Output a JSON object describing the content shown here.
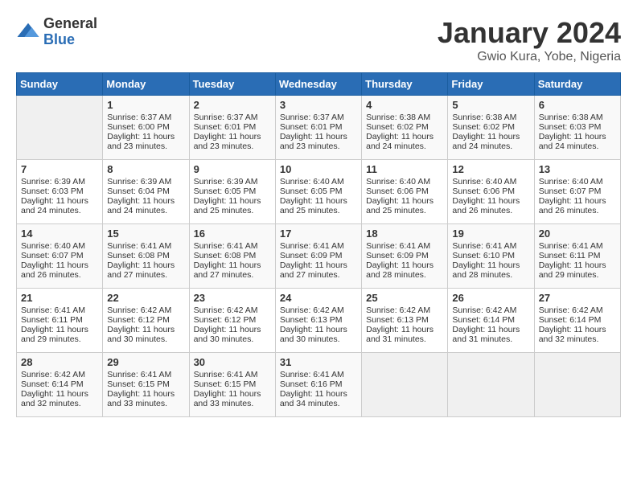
{
  "header": {
    "logo_general": "General",
    "logo_blue": "Blue",
    "month_title": "January 2024",
    "location": "Gwio Kura, Yobe, Nigeria"
  },
  "weekdays": [
    "Sunday",
    "Monday",
    "Tuesday",
    "Wednesday",
    "Thursday",
    "Friday",
    "Saturday"
  ],
  "weeks": [
    [
      {
        "day": "",
        "sunrise": "",
        "sunset": "",
        "daylight": ""
      },
      {
        "day": "1",
        "sunrise": "Sunrise: 6:37 AM",
        "sunset": "Sunset: 6:00 PM",
        "daylight": "Daylight: 11 hours and 23 minutes."
      },
      {
        "day": "2",
        "sunrise": "Sunrise: 6:37 AM",
        "sunset": "Sunset: 6:01 PM",
        "daylight": "Daylight: 11 hours and 23 minutes."
      },
      {
        "day": "3",
        "sunrise": "Sunrise: 6:37 AM",
        "sunset": "Sunset: 6:01 PM",
        "daylight": "Daylight: 11 hours and 23 minutes."
      },
      {
        "day": "4",
        "sunrise": "Sunrise: 6:38 AM",
        "sunset": "Sunset: 6:02 PM",
        "daylight": "Daylight: 11 hours and 24 minutes."
      },
      {
        "day": "5",
        "sunrise": "Sunrise: 6:38 AM",
        "sunset": "Sunset: 6:02 PM",
        "daylight": "Daylight: 11 hours and 24 minutes."
      },
      {
        "day": "6",
        "sunrise": "Sunrise: 6:38 AM",
        "sunset": "Sunset: 6:03 PM",
        "daylight": "Daylight: 11 hours and 24 minutes."
      }
    ],
    [
      {
        "day": "7",
        "sunrise": "Sunrise: 6:39 AM",
        "sunset": "Sunset: 6:03 PM",
        "daylight": "Daylight: 11 hours and 24 minutes."
      },
      {
        "day": "8",
        "sunrise": "Sunrise: 6:39 AM",
        "sunset": "Sunset: 6:04 PM",
        "daylight": "Daylight: 11 hours and 24 minutes."
      },
      {
        "day": "9",
        "sunrise": "Sunrise: 6:39 AM",
        "sunset": "Sunset: 6:05 PM",
        "daylight": "Daylight: 11 hours and 25 minutes."
      },
      {
        "day": "10",
        "sunrise": "Sunrise: 6:40 AM",
        "sunset": "Sunset: 6:05 PM",
        "daylight": "Daylight: 11 hours and 25 minutes."
      },
      {
        "day": "11",
        "sunrise": "Sunrise: 6:40 AM",
        "sunset": "Sunset: 6:06 PM",
        "daylight": "Daylight: 11 hours and 25 minutes."
      },
      {
        "day": "12",
        "sunrise": "Sunrise: 6:40 AM",
        "sunset": "Sunset: 6:06 PM",
        "daylight": "Daylight: 11 hours and 26 minutes."
      },
      {
        "day": "13",
        "sunrise": "Sunrise: 6:40 AM",
        "sunset": "Sunset: 6:07 PM",
        "daylight": "Daylight: 11 hours and 26 minutes."
      }
    ],
    [
      {
        "day": "14",
        "sunrise": "Sunrise: 6:40 AM",
        "sunset": "Sunset: 6:07 PM",
        "daylight": "Daylight: 11 hours and 26 minutes."
      },
      {
        "day": "15",
        "sunrise": "Sunrise: 6:41 AM",
        "sunset": "Sunset: 6:08 PM",
        "daylight": "Daylight: 11 hours and 27 minutes."
      },
      {
        "day": "16",
        "sunrise": "Sunrise: 6:41 AM",
        "sunset": "Sunset: 6:08 PM",
        "daylight": "Daylight: 11 hours and 27 minutes."
      },
      {
        "day": "17",
        "sunrise": "Sunrise: 6:41 AM",
        "sunset": "Sunset: 6:09 PM",
        "daylight": "Daylight: 11 hours and 27 minutes."
      },
      {
        "day": "18",
        "sunrise": "Sunrise: 6:41 AM",
        "sunset": "Sunset: 6:09 PM",
        "daylight": "Daylight: 11 hours and 28 minutes."
      },
      {
        "day": "19",
        "sunrise": "Sunrise: 6:41 AM",
        "sunset": "Sunset: 6:10 PM",
        "daylight": "Daylight: 11 hours and 28 minutes."
      },
      {
        "day": "20",
        "sunrise": "Sunrise: 6:41 AM",
        "sunset": "Sunset: 6:11 PM",
        "daylight": "Daylight: 11 hours and 29 minutes."
      }
    ],
    [
      {
        "day": "21",
        "sunrise": "Sunrise: 6:41 AM",
        "sunset": "Sunset: 6:11 PM",
        "daylight": "Daylight: 11 hours and 29 minutes."
      },
      {
        "day": "22",
        "sunrise": "Sunrise: 6:42 AM",
        "sunset": "Sunset: 6:12 PM",
        "daylight": "Daylight: 11 hours and 30 minutes."
      },
      {
        "day": "23",
        "sunrise": "Sunrise: 6:42 AM",
        "sunset": "Sunset: 6:12 PM",
        "daylight": "Daylight: 11 hours and 30 minutes."
      },
      {
        "day": "24",
        "sunrise": "Sunrise: 6:42 AM",
        "sunset": "Sunset: 6:13 PM",
        "daylight": "Daylight: 11 hours and 30 minutes."
      },
      {
        "day": "25",
        "sunrise": "Sunrise: 6:42 AM",
        "sunset": "Sunset: 6:13 PM",
        "daylight": "Daylight: 11 hours and 31 minutes."
      },
      {
        "day": "26",
        "sunrise": "Sunrise: 6:42 AM",
        "sunset": "Sunset: 6:14 PM",
        "daylight": "Daylight: 11 hours and 31 minutes."
      },
      {
        "day": "27",
        "sunrise": "Sunrise: 6:42 AM",
        "sunset": "Sunset: 6:14 PM",
        "daylight": "Daylight: 11 hours and 32 minutes."
      }
    ],
    [
      {
        "day": "28",
        "sunrise": "Sunrise: 6:42 AM",
        "sunset": "Sunset: 6:14 PM",
        "daylight": "Daylight: 11 hours and 32 minutes."
      },
      {
        "day": "29",
        "sunrise": "Sunrise: 6:41 AM",
        "sunset": "Sunset: 6:15 PM",
        "daylight": "Daylight: 11 hours and 33 minutes."
      },
      {
        "day": "30",
        "sunrise": "Sunrise: 6:41 AM",
        "sunset": "Sunset: 6:15 PM",
        "daylight": "Daylight: 11 hours and 33 minutes."
      },
      {
        "day": "31",
        "sunrise": "Sunrise: 6:41 AM",
        "sunset": "Sunset: 6:16 PM",
        "daylight": "Daylight: 11 hours and 34 minutes."
      },
      {
        "day": "",
        "sunrise": "",
        "sunset": "",
        "daylight": ""
      },
      {
        "day": "",
        "sunrise": "",
        "sunset": "",
        "daylight": ""
      },
      {
        "day": "",
        "sunrise": "",
        "sunset": "",
        "daylight": ""
      }
    ]
  ]
}
